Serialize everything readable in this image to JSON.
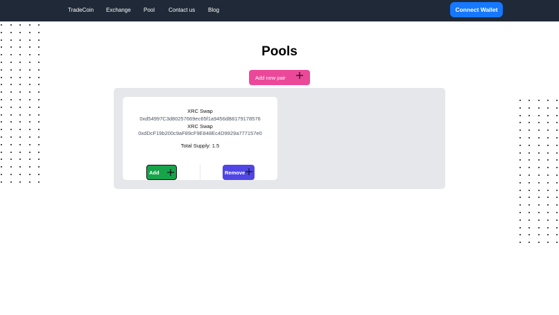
{
  "nav": {
    "links": [
      "TradeCoin",
      "Exchange",
      "Pool",
      "Contact us",
      "Blog"
    ],
    "connect_label": "Connect Wallet"
  },
  "page": {
    "title": "Pools",
    "add_pair_label": "Add new pair"
  },
  "pool": {
    "token_a_name": "XRC Swap",
    "token_a_address": "0xd54997C3d80257669ec65f1a9456dB8179178576",
    "token_b_name": "XRC Swap",
    "token_b_address": "0xdDcF19b200c9aF89cF9E848Ec4D9929a777157e0",
    "total_supply": "Total Supply: 1.5",
    "add_label": "Add",
    "remove_label": "Remove"
  },
  "icons": {
    "plus": "plus-icon"
  },
  "colors": {
    "navbar": "#1f2937",
    "connect": "#1677ff",
    "add_pair": "#ec4899",
    "panel": "#e5e7eb",
    "add": "#16a34a",
    "remove": "#4f46e5"
  }
}
